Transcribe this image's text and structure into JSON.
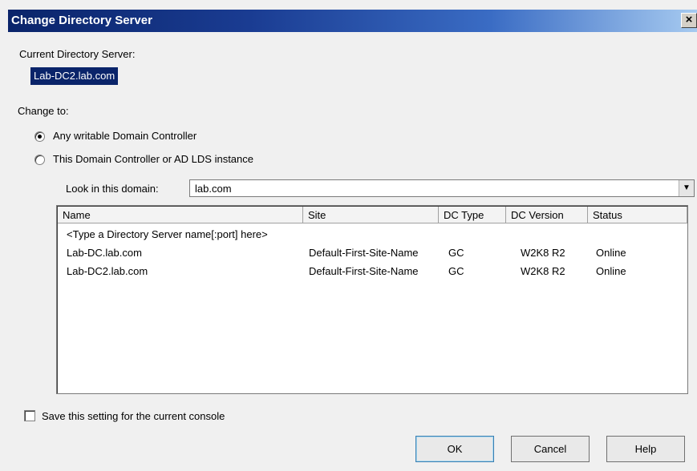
{
  "window": {
    "title": "Change Directory Server",
    "close_glyph": "×"
  },
  "current": {
    "label": "Current Directory Server:",
    "value": "Lab-DC2.lab.com"
  },
  "change_to": {
    "label": "Change to:",
    "options": [
      {
        "label": "Any writable Domain Controller",
        "selected": true
      },
      {
        "label": "This Domain Controller or AD LDS instance",
        "selected": false
      }
    ]
  },
  "domain": {
    "label": "Look in this domain:",
    "value": "lab.com"
  },
  "table": {
    "headers": [
      "Name",
      "Site",
      "DC Type",
      "DC Version",
      "Status"
    ],
    "placeholder_row": "<Type a Directory Server name[:port] here>",
    "rows": [
      [
        "Lab-DC.lab.com",
        "Default-First-Site-Name",
        "GC",
        "W2K8 R2",
        "Online"
      ],
      [
        "Lab-DC2.lab.com",
        "Default-First-Site-Name",
        "GC",
        "W2K8 R2",
        "Online"
      ]
    ]
  },
  "save_setting": {
    "label": "Save this setting for the current console",
    "checked": false
  },
  "buttons": {
    "ok": "OK",
    "cancel": "Cancel",
    "help": "Help"
  }
}
